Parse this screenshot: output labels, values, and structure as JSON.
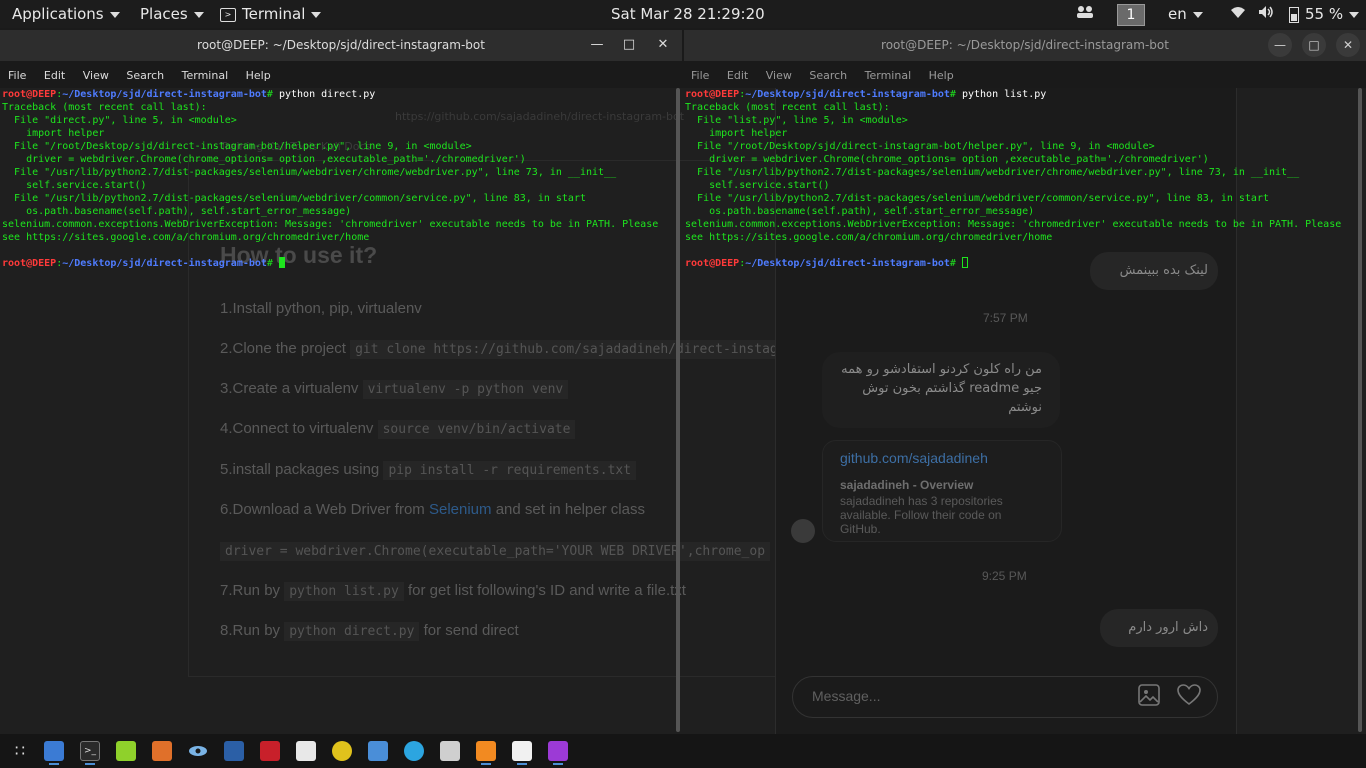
{
  "top_panel": {
    "applications": "Applications",
    "places": "Places",
    "terminal": "Terminal",
    "datetime": "Sat Mar 28  21:29:20",
    "workspace": "1",
    "language": "en",
    "battery": "55 %"
  },
  "left_terminal": {
    "title": "root@DEEP: ~/Desktop/sjd/direct-instagram-bot",
    "menu": [
      "File",
      "Edit",
      "View",
      "Search",
      "Terminal",
      "Help"
    ],
    "prompt_user": "root@DEEP",
    "prompt_path": "~/Desktop/sjd/direct-instagram-bot",
    "command": "python direct.py",
    "output": [
      "Traceback (most recent call last):",
      "  File \"direct.py\", line 5, in <module>",
      "    import helper",
      "  File \"/root/Desktop/sjd/direct-instagram-bot/helper.py\", line 9, in <module>",
      "    driver = webdriver.Chrome(chrome_options= option ,executable_path='./chromedriver')",
      "  File \"/usr/lib/python2.7/dist-packages/selenium/webdriver/chrome/webdriver.py\", line 73, in __init__",
      "    self.service.start()",
      "  File \"/usr/lib/python2.7/dist-packages/selenium/webdriver/common/service.py\", line 83, in start",
      "    os.path.basename(self.path), self.start_error_message)",
      "selenium.common.exceptions.WebDriverException: Message: 'chromedriver' executable needs to be in PATH. Please see https://sites.google.com/a/chromium.org/chromedriver/home"
    ]
  },
  "right_terminal": {
    "title": "root@DEEP: ~/Desktop/sjd/direct-instagram-bot",
    "menu": [
      "File",
      "Edit",
      "View",
      "Search",
      "Terminal",
      "Help"
    ],
    "prompt_user": "root@DEEP",
    "prompt_path": "~/Desktop/sjd/direct-instagram-bot",
    "command": "python list.py",
    "output": [
      "Traceback (most recent call last):",
      "  File \"list.py\", line 5, in <module>",
      "    import helper",
      "  File \"/root/Desktop/sjd/direct-instagram-bot/helper.py\", line 9, in <module>",
      "    driver = webdriver.Chrome(chrome_options= option ,executable_path='./chromedriver')",
      "  File \"/usr/lib/python2.7/dist-packages/selenium/webdriver/chrome/webdriver.py\", line 73, in __init__",
      "    self.service.start()",
      "  File \"/usr/lib/python2.7/dist-packages/selenium/webdriver/common/service.py\", line 83, in start",
      "    os.path.basename(self.path), self.start_error_message)",
      "selenium.common.exceptions.WebDriverException: Message: 'chromedriver' executable needs to be in PATH. Please see https://sites.google.com/a/chromium.org/chromedriver/home"
    ]
  },
  "browser_bg": {
    "url": "https://github.com/sajadadineh/direct-instagram-bot",
    "bookmarks": "Training     Kali Tools     Kali Docs",
    "heading": "How to use it?",
    "steps": [
      {
        "text": "1.Install python, pip, virtualenv",
        "code": ""
      },
      {
        "text": "2.Clone the project",
        "code": "git clone https://github.com/sajadadineh/direct-instagram-bot"
      },
      {
        "text": "3.Create a virtualenv",
        "code": "virtualenv -p python venv"
      },
      {
        "text": "4.Connect to virtualenv",
        "code": "source venv/bin/activate"
      },
      {
        "text": "5.install packages using",
        "code": "pip install -r requirements.txt"
      },
      {
        "text": "6.Download a Web Driver from",
        "link": "Selenium",
        "after": "and set in helper class"
      },
      {
        "text": "",
        "code": "driver = webdriver.Chrome(executable_path='YOUR WEB DRIVER',chrome_op"
      },
      {
        "text": "7.Run by",
        "code": "python list.py",
        "after": "for get list following's ID and write a file.txt"
      },
      {
        "text": "8.Run by",
        "code": "python direct.py",
        "after": "for send direct"
      }
    ]
  },
  "instagram": {
    "bubble_1": "لینک بده ببینمش",
    "time_1": "7:57 PM",
    "bubble_2": "من راه کلون کردنو استفادشو رو همه جیو readme گذاشتم بخون توش نوشتم",
    "card_link": "github.com/sajadadineh",
    "card_title": "sajadadineh - Overview",
    "card_desc": "sajadadineh has 3 repositories available. Follow their code on GitHub.",
    "time_2": "9:25 PM",
    "bubble_3": "داش ارور دارم",
    "message_placeholder": "Message..."
  },
  "colors": {
    "terminal_text": "#1ee51e",
    "prompt_user": "#ff3a3a",
    "prompt_path": "#4f7cff"
  },
  "dock_icons": [
    "apps-grid-icon",
    "files-icon",
    "terminal-icon",
    "notes-icon",
    "burpsuite-icon",
    "eye-icon",
    "metasploit-icon",
    "cherrytree-icon",
    "settings-icon",
    "wifi-icon",
    "folder-icon",
    "telegram-icon",
    "keyboard-icon",
    "firefox-icon",
    "screenshot-icon",
    "phpstorm-icon"
  ]
}
